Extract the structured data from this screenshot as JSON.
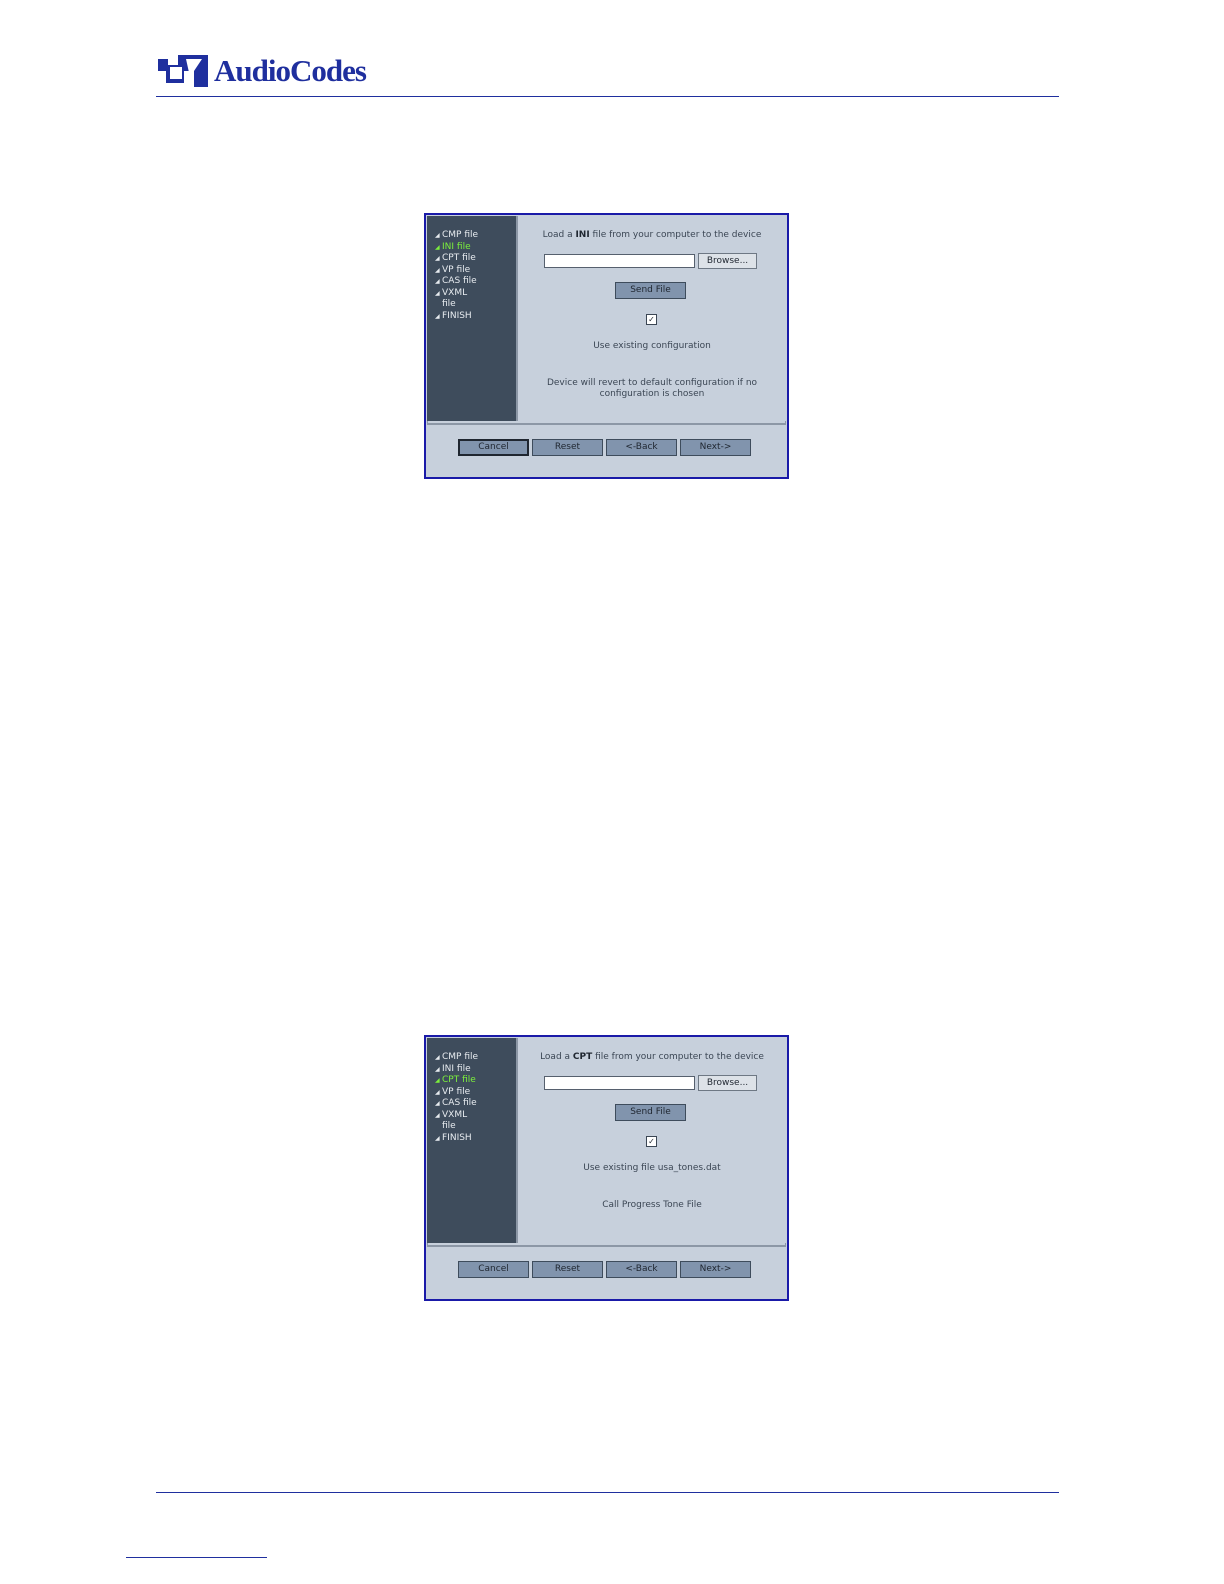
{
  "header": {
    "brand": "AudioCodes",
    "accent_color": "#1f2f9e"
  },
  "wizards": [
    {
      "steps": [
        {
          "label": "CMP file",
          "active": false
        },
        {
          "label": "INI file",
          "active": true
        },
        {
          "label": "CPT file",
          "active": false
        },
        {
          "label": "VP file",
          "active": false
        },
        {
          "label": "CAS file",
          "active": false
        },
        {
          "label": "VXML\nfile",
          "active": false
        },
        {
          "label": "FINISH",
          "active": false
        }
      ],
      "title_prefix": "Load a ",
      "title_bold": "INI",
      "title_suffix": " file from your computer to the device",
      "file_value": "",
      "browse_label": "Browse...",
      "send_label": "Send File",
      "checkbox_checked": true,
      "checkbox_mark": "✓",
      "line1": "Use existing configuration",
      "line2": "Device will revert to default configuration if no configuration is chosen",
      "buttons": {
        "cancel": "Cancel",
        "reset": "Reset",
        "back": "<-Back",
        "next": "Next->"
      }
    },
    {
      "steps": [
        {
          "label": "CMP file",
          "active": false
        },
        {
          "label": "INI file",
          "active": false
        },
        {
          "label": "CPT file",
          "active": true
        },
        {
          "label": "VP file",
          "active": false
        },
        {
          "label": "CAS file",
          "active": false
        },
        {
          "label": "VXML\nfile",
          "active": false
        },
        {
          "label": "FINISH",
          "active": false
        }
      ],
      "title_prefix": "Load a ",
      "title_bold": "CPT",
      "title_suffix": " file from your computer to the device",
      "file_value": "",
      "browse_label": "Browse...",
      "send_label": "Send File",
      "checkbox_checked": true,
      "checkbox_mark": "✓",
      "line1": "Use existing file usa_tones.dat",
      "line2": "Call Progress Tone File",
      "buttons": {
        "cancel": "Cancel",
        "reset": "Reset",
        "back": "<-Back",
        "next": "Next->"
      }
    }
  ]
}
